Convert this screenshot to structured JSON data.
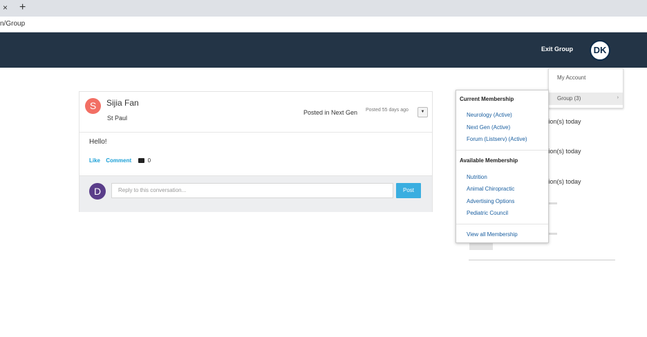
{
  "browser": {
    "tab_close": "×",
    "tab_new": "+",
    "url_fragment": "n/Group"
  },
  "header": {
    "exit_group": "Exit Group",
    "avatar_initials": "DK",
    "bg_color": "#233446"
  },
  "post": {
    "author_initial": "S",
    "author_name": "Sijia Fan",
    "author_location": "St Paul",
    "posted_in": "Posted in Next Gen",
    "posted_time": "Posted 55 days ago",
    "body": "Hello!",
    "like_label": "Like",
    "comment_label": "Comment",
    "comment_count": "0",
    "reply_initial": "D",
    "reply_placeholder": "Reply to this conversation...",
    "post_button": "Post"
  },
  "background": {
    "notif1": "tion(s) today",
    "notif2": "tion(s) today",
    "notif3_link": ")",
    "notif3": "tion(s) today"
  },
  "account_menu": {
    "my_account": "My Account",
    "group": "Group (3)",
    "arrow": "›"
  },
  "membership_menu": {
    "current_heading": "Current Membership",
    "current": [
      "Neurology (Active)",
      "Next Gen (Active)",
      "Forum (Listserv) (Active)"
    ],
    "available_heading": "Available Membership",
    "available": [
      "Nutrition",
      "Animal Chiropractic",
      "Advertising Options",
      "Pediatric Council"
    ],
    "view_all": "View all Membership"
  }
}
